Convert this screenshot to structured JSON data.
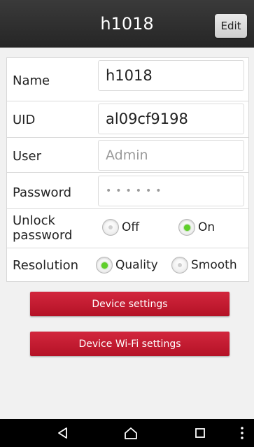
{
  "header": {
    "title": "h1018",
    "edit_label": "Edit"
  },
  "form": {
    "name": {
      "label": "Name",
      "value": "h1018"
    },
    "uid": {
      "label": "UID",
      "value": "al09cf9198"
    },
    "user": {
      "label": "User",
      "placeholder": "Admin"
    },
    "password": {
      "label": "Password",
      "masked": "••••••"
    },
    "unlock": {
      "label_line1": "Unlock",
      "label_line2": "password",
      "options": [
        {
          "label": "Off",
          "selected": false
        },
        {
          "label": "On",
          "selected": true
        }
      ]
    },
    "resolution": {
      "label": "Resolution",
      "options": [
        {
          "label": "Quality",
          "selected": true
        },
        {
          "label": "Smooth",
          "selected": false
        }
      ]
    }
  },
  "buttons": {
    "device_settings": "Device settings",
    "device_wifi_settings": "Device Wi-Fi settings"
  },
  "navbar": {
    "icons": [
      "back-icon",
      "home-icon",
      "recents-icon",
      "menu-icon"
    ]
  },
  "colors": {
    "header_bg": "#2e2e2e",
    "button_red": "#c41a31",
    "radio_selected": "#5fcf2a"
  }
}
